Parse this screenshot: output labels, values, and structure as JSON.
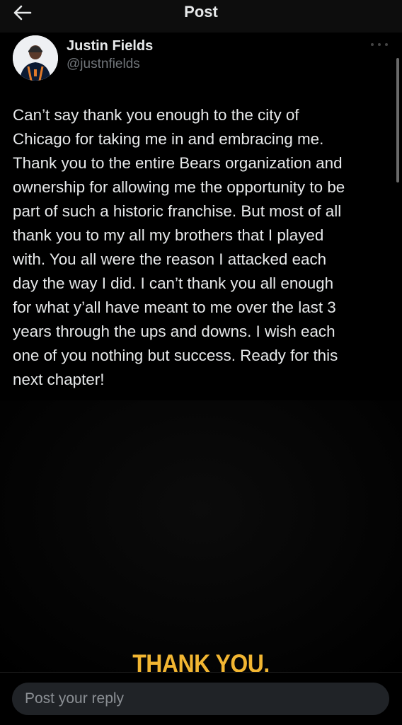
{
  "header": {
    "title": "Post",
    "back_icon": "arrow-left-icon"
  },
  "post": {
    "author": {
      "name": "Justin Fields",
      "handle": "@justnfields"
    },
    "more_icon": "more-horizontal-icon",
    "text": "Can’t say thank you enough to the city of\nChicago for taking me in and embracing me.\nThank you to the entire Bears organization and\nownership for allowing me the opportunity to be\npart of such a historic franchise. But most of all\nthank you to my all my brothers that I played\nwith. You all were the reason I attacked each\nday the way I did. I can’t thank you all enough\nfor what y’all have meant to me over the last 3\nyears through the ups and downs. I wish  each\none of you nothing but success. Ready for this\nnext chapter!",
    "image_caption": "THANK YOU.",
    "accent_color": "#f2b632"
  },
  "reply": {
    "placeholder": "Post your reply",
    "value": ""
  }
}
